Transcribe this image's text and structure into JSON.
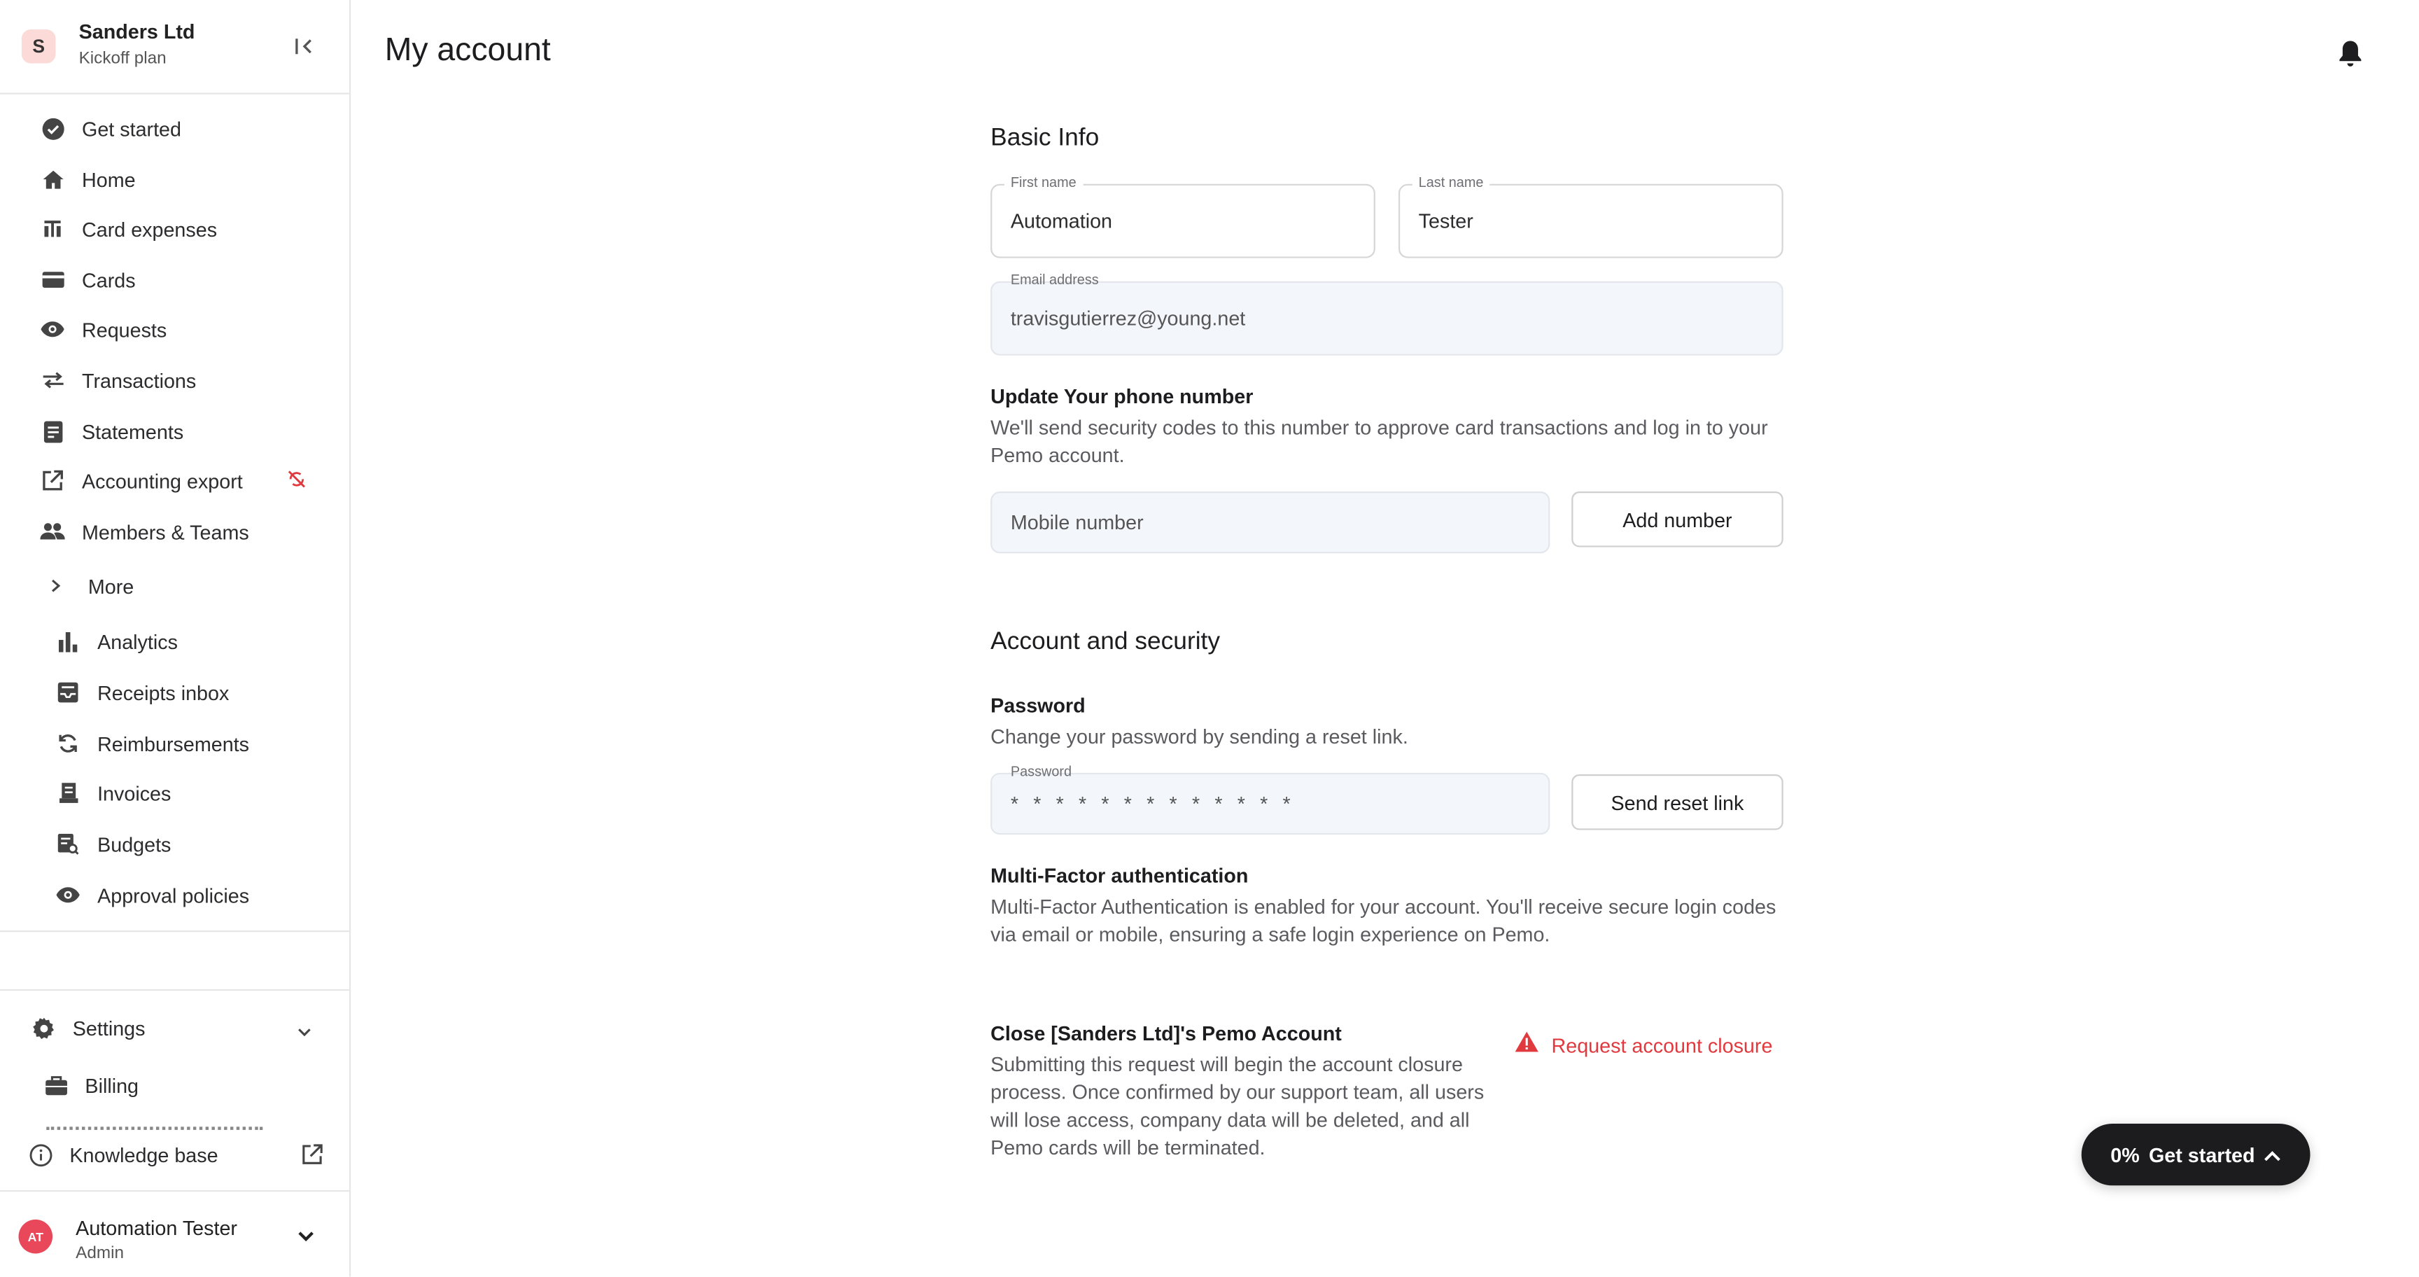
{
  "org": {
    "initial": "S",
    "name": "Sanders Ltd",
    "plan": "Kickoff plan"
  },
  "nav": {
    "items": [
      {
        "label": "Get started",
        "icon": "check-circle-icon"
      },
      {
        "label": "Home",
        "icon": "home-icon"
      },
      {
        "label": "Card expenses",
        "icon": "receipt-icon"
      },
      {
        "label": "Cards",
        "icon": "card-icon"
      },
      {
        "label": "Requests",
        "icon": "eye-icon"
      },
      {
        "label": "Transactions",
        "icon": "swap-arrows-icon"
      },
      {
        "label": "Statements",
        "icon": "statement-icon"
      },
      {
        "label": "Accounting export",
        "icon": "export-icon"
      },
      {
        "label": "Members & Teams",
        "icon": "people-icon"
      }
    ],
    "more_label": "More",
    "more_items": [
      {
        "label": "Analytics",
        "icon": "bar-chart-icon"
      },
      {
        "label": "Receipts inbox",
        "icon": "inbox-icon"
      },
      {
        "label": "Reimbursements",
        "icon": "refresh-icon"
      },
      {
        "label": "Invoices",
        "icon": "invoice-icon"
      },
      {
        "label": "Budgets",
        "icon": "budget-icon"
      },
      {
        "label": "Approval policies",
        "icon": "eye-icon"
      }
    ],
    "settings_label": "Settings",
    "billing_label": "Billing",
    "knowledge_base_label": "Knowledge base"
  },
  "user": {
    "initials": "AT",
    "name": "Automation Tester",
    "role": "Admin"
  },
  "header": {
    "title": "My account"
  },
  "basic_info": {
    "title": "Basic Info",
    "first_name_label": "First name",
    "first_name_value": "Automation",
    "last_name_label": "Last name",
    "last_name_value": "Tester",
    "email_label": "Email address",
    "email_value": "travisgutierrez@young.net"
  },
  "phone": {
    "title": "Update Your phone number",
    "desc_line1": "We'll send security codes to this number to approve card transactions and log in to your",
    "desc_line2": "Pemo account.",
    "placeholder": "Mobile number",
    "button": "Add number"
  },
  "security": {
    "title": "Account and security",
    "password_title": "Password",
    "password_desc": "Change your password by sending a reset link.",
    "password_label": "Password",
    "password_mask": "* * * * * * * * * * * * *",
    "reset_button": "Send reset link",
    "mfa_title": "Multi-Factor authentication",
    "mfa_desc_line1": "Multi-Factor Authentication is enabled for your account. You'll receive secure login codes",
    "mfa_desc_line2": "via email or mobile, ensuring a safe login experience on Pemo."
  },
  "closure": {
    "title": "Close [Sanders Ltd]'s Pemo Account",
    "desc_line1": "Submitting this request will begin the account closure",
    "desc_line2": "process. Once confirmed by our support team, all users",
    "desc_line3": "will lose access, company data will be deleted, and all",
    "desc_line4": "Pemo cards will be terminated.",
    "link": "Request account closure"
  },
  "fab": {
    "progress": "0%",
    "label": "Get started"
  },
  "colors": {
    "danger": "#e0393e",
    "fab_bg": "#1c1c1e",
    "avatar_user": "#e9485a",
    "avatar_org": "#fbdad7"
  }
}
